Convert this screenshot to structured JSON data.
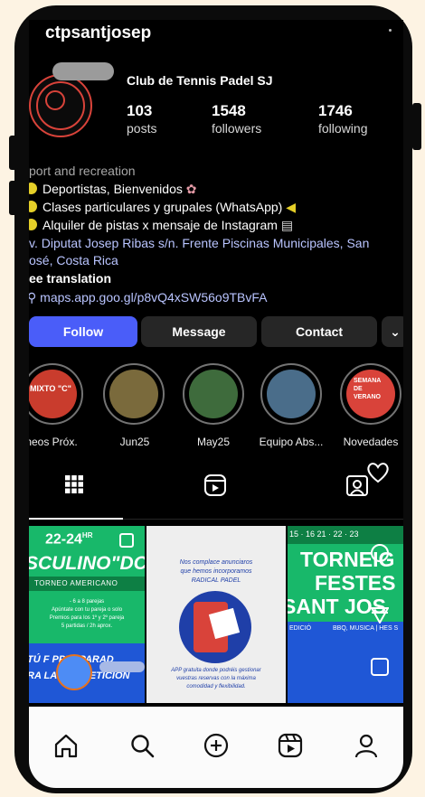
{
  "profile": {
    "username": "ctpsantjosep",
    "club_name": "Club de Tennis Padel SJ",
    "posts_count": "103",
    "posts_label": "posts",
    "followers_count": "1548",
    "followers_label": "followers",
    "following_count": "1746",
    "following_label": "following"
  },
  "bio": {
    "category": "port and recreation",
    "line1": "Deportistas, Bienvenidos",
    "line2": "Clases particulares y grupales (WhatsApp)",
    "line3": "Alquiler de pistas x mensaje de Instagram",
    "address1": "v. Diputat Josep Ribas s/n. Frente Piscinas Municipales, San",
    "address2": "osé, Costa Rica",
    "translation": "ee translation",
    "link": "maps.app.goo.gl/p8vQ4xSW56o9TBvFA"
  },
  "actions": {
    "follow": "Follow",
    "message": "Message",
    "contact": "Contact",
    "more": "⌄"
  },
  "highlights": [
    {
      "label": "neos Próx.",
      "cover_text": "MIXTO \"C\"",
      "color": "#c93c2d"
    },
    {
      "label": "Jun25",
      "color": "#7a6a3c"
    },
    {
      "label": "May25",
      "color": "#3e6b3c"
    },
    {
      "label": "Equipo Abs...",
      "color": "#4a6d8a"
    },
    {
      "label": "Novedades",
      "cover_text": "SEMANA DE VERANO",
      "color": "#d9433a"
    }
  ],
  "posts": [
    {
      "date": "22-24",
      "date_sup": "HR",
      "title": "SCULINO\"DC",
      "subtitle": "TORNEO AMERICANO",
      "info1": "- 6 a 8 parejas",
      "info2": "Apúntate con tu pareja o solo",
      "info3": "Premios para los 1º y 2º pareja",
      "info4": "5 partidas / 2h aprox.",
      "promo1": "TÚ F    PPREPARAD",
      "promo2": "RA LA COMPETICIÓN",
      "bg": "#18b86a"
    },
    {
      "text1": "Nos complace anunciaros",
      "text2": "que hemos incorporamos",
      "text3": "RADICAL PADEL",
      "bottom1": "APP gratuita donde podréis gestionar",
      "bottom2": "vuestras reservas con la máxima",
      "bottom3": "comodidad y flexibilidad."
    },
    {
      "dates": "15 · 16     21 · 22 · 23",
      "title1": "TORNEIG",
      "title2": "FESTES",
      "title3": "SANT JOS",
      "tag1": "EDICIÓ",
      "tag2": "BBQ, MUSICA | HES S"
    }
  ],
  "colors": {
    "accent": "#4a5df9",
    "link": "#b9c4ff",
    "brand_red": "#d9433a",
    "post_green": "#18b86a",
    "post_blue": "#1f57d6"
  }
}
